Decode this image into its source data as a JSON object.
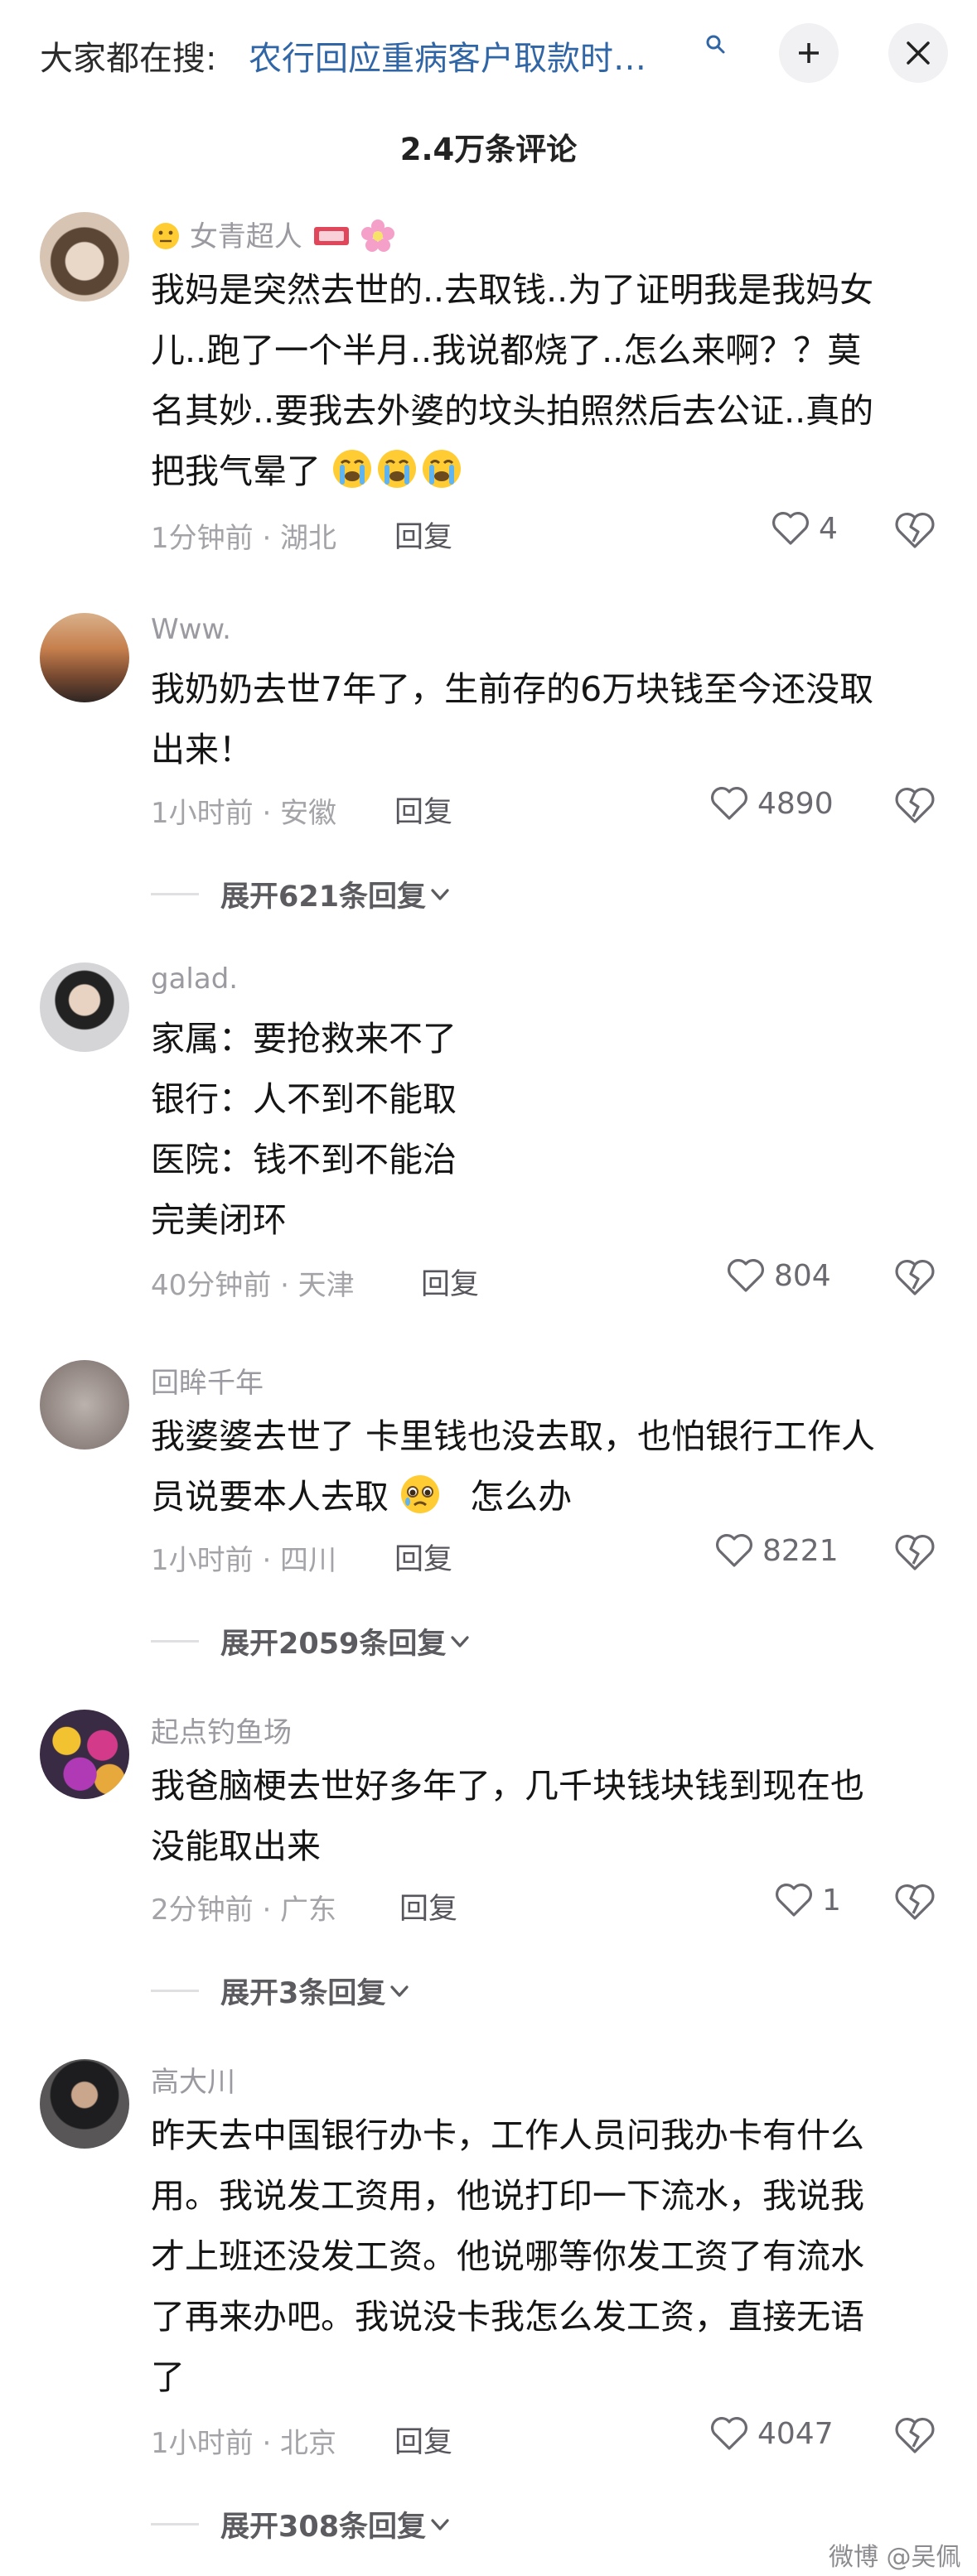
{
  "search_bar": {
    "prefix": "大家都在搜:",
    "query": "农行回应重病客户取款时…",
    "search_icon": "search-icon",
    "collapse_icon": "collapse-icon",
    "close_icon": "close-icon"
  },
  "comments_title": "2.4万条评论",
  "reply_label": "回复",
  "comments": [
    {
      "username": "女青超人",
      "username_emojis": [
        "grimace-face-emoji",
        "ticket-emoji",
        "flower-emoji"
      ],
      "lines": [
        "我妈是突然去世的..去取钱..为了证明我是我妈女",
        "儿..跑了一个半月..我说都烧了..怎么来啊？？莫",
        "名其妙..要我去外婆的坟头拍照然后去公证..真的",
        "把我气晕了"
      ],
      "trailing_emojis": [
        "loudly-crying-face-emoji",
        "loudly-crying-face-emoji",
        "loudly-crying-face-emoji"
      ],
      "time_location": "1分钟前 · 湖北",
      "likes": "4",
      "expand": ""
    },
    {
      "username": "Www.",
      "lines": [
        "我奶奶去世7年了，生前存的6万块钱至今还没取",
        "出来！"
      ],
      "time_location": "1小时前 · 安徽",
      "likes": "4890",
      "expand": "展开621条回复"
    },
    {
      "username": "galad.",
      "lines": [
        "家属：要抢救来不了",
        "银行：人不到不能取",
        "医院：钱不到不能治",
        "完美闭环"
      ],
      "time_location": "40分钟前 · 天津",
      "likes": "804",
      "expand": ""
    },
    {
      "username": "回眸千年",
      "lines": [
        "我婆婆去世了  卡里钱也没去取，也怕银行工作人",
        "员说要本人去取"
      ],
      "line2_tail": "怎么办",
      "time_location": "1小时前 · 四川",
      "likes": "8221",
      "expand": "展开2059条回复"
    },
    {
      "username": "起点钓鱼场",
      "lines": [
        "我爸脑梗去世好多年了，几千块钱块钱到现在也",
        "没能取出来"
      ],
      "time_location": "2分钟前 · 广东",
      "likes": "1",
      "expand": "展开3条回复"
    },
    {
      "username": "高大川",
      "lines": [
        "昨天去中国银行办卡，工作人员问我办卡有什么",
        "用。我说发工资用，他说打印一下流水，我说我",
        "才上班还没发工资。他说哪等你发工资了有流水",
        "了再来办吧。我说没卡我怎么发工资，直接无语",
        "了"
      ],
      "time_location": "1小时前 · 北京",
      "likes": "4047",
      "expand": "展开308条回复"
    }
  ],
  "watermark": "微博 @吴佩"
}
